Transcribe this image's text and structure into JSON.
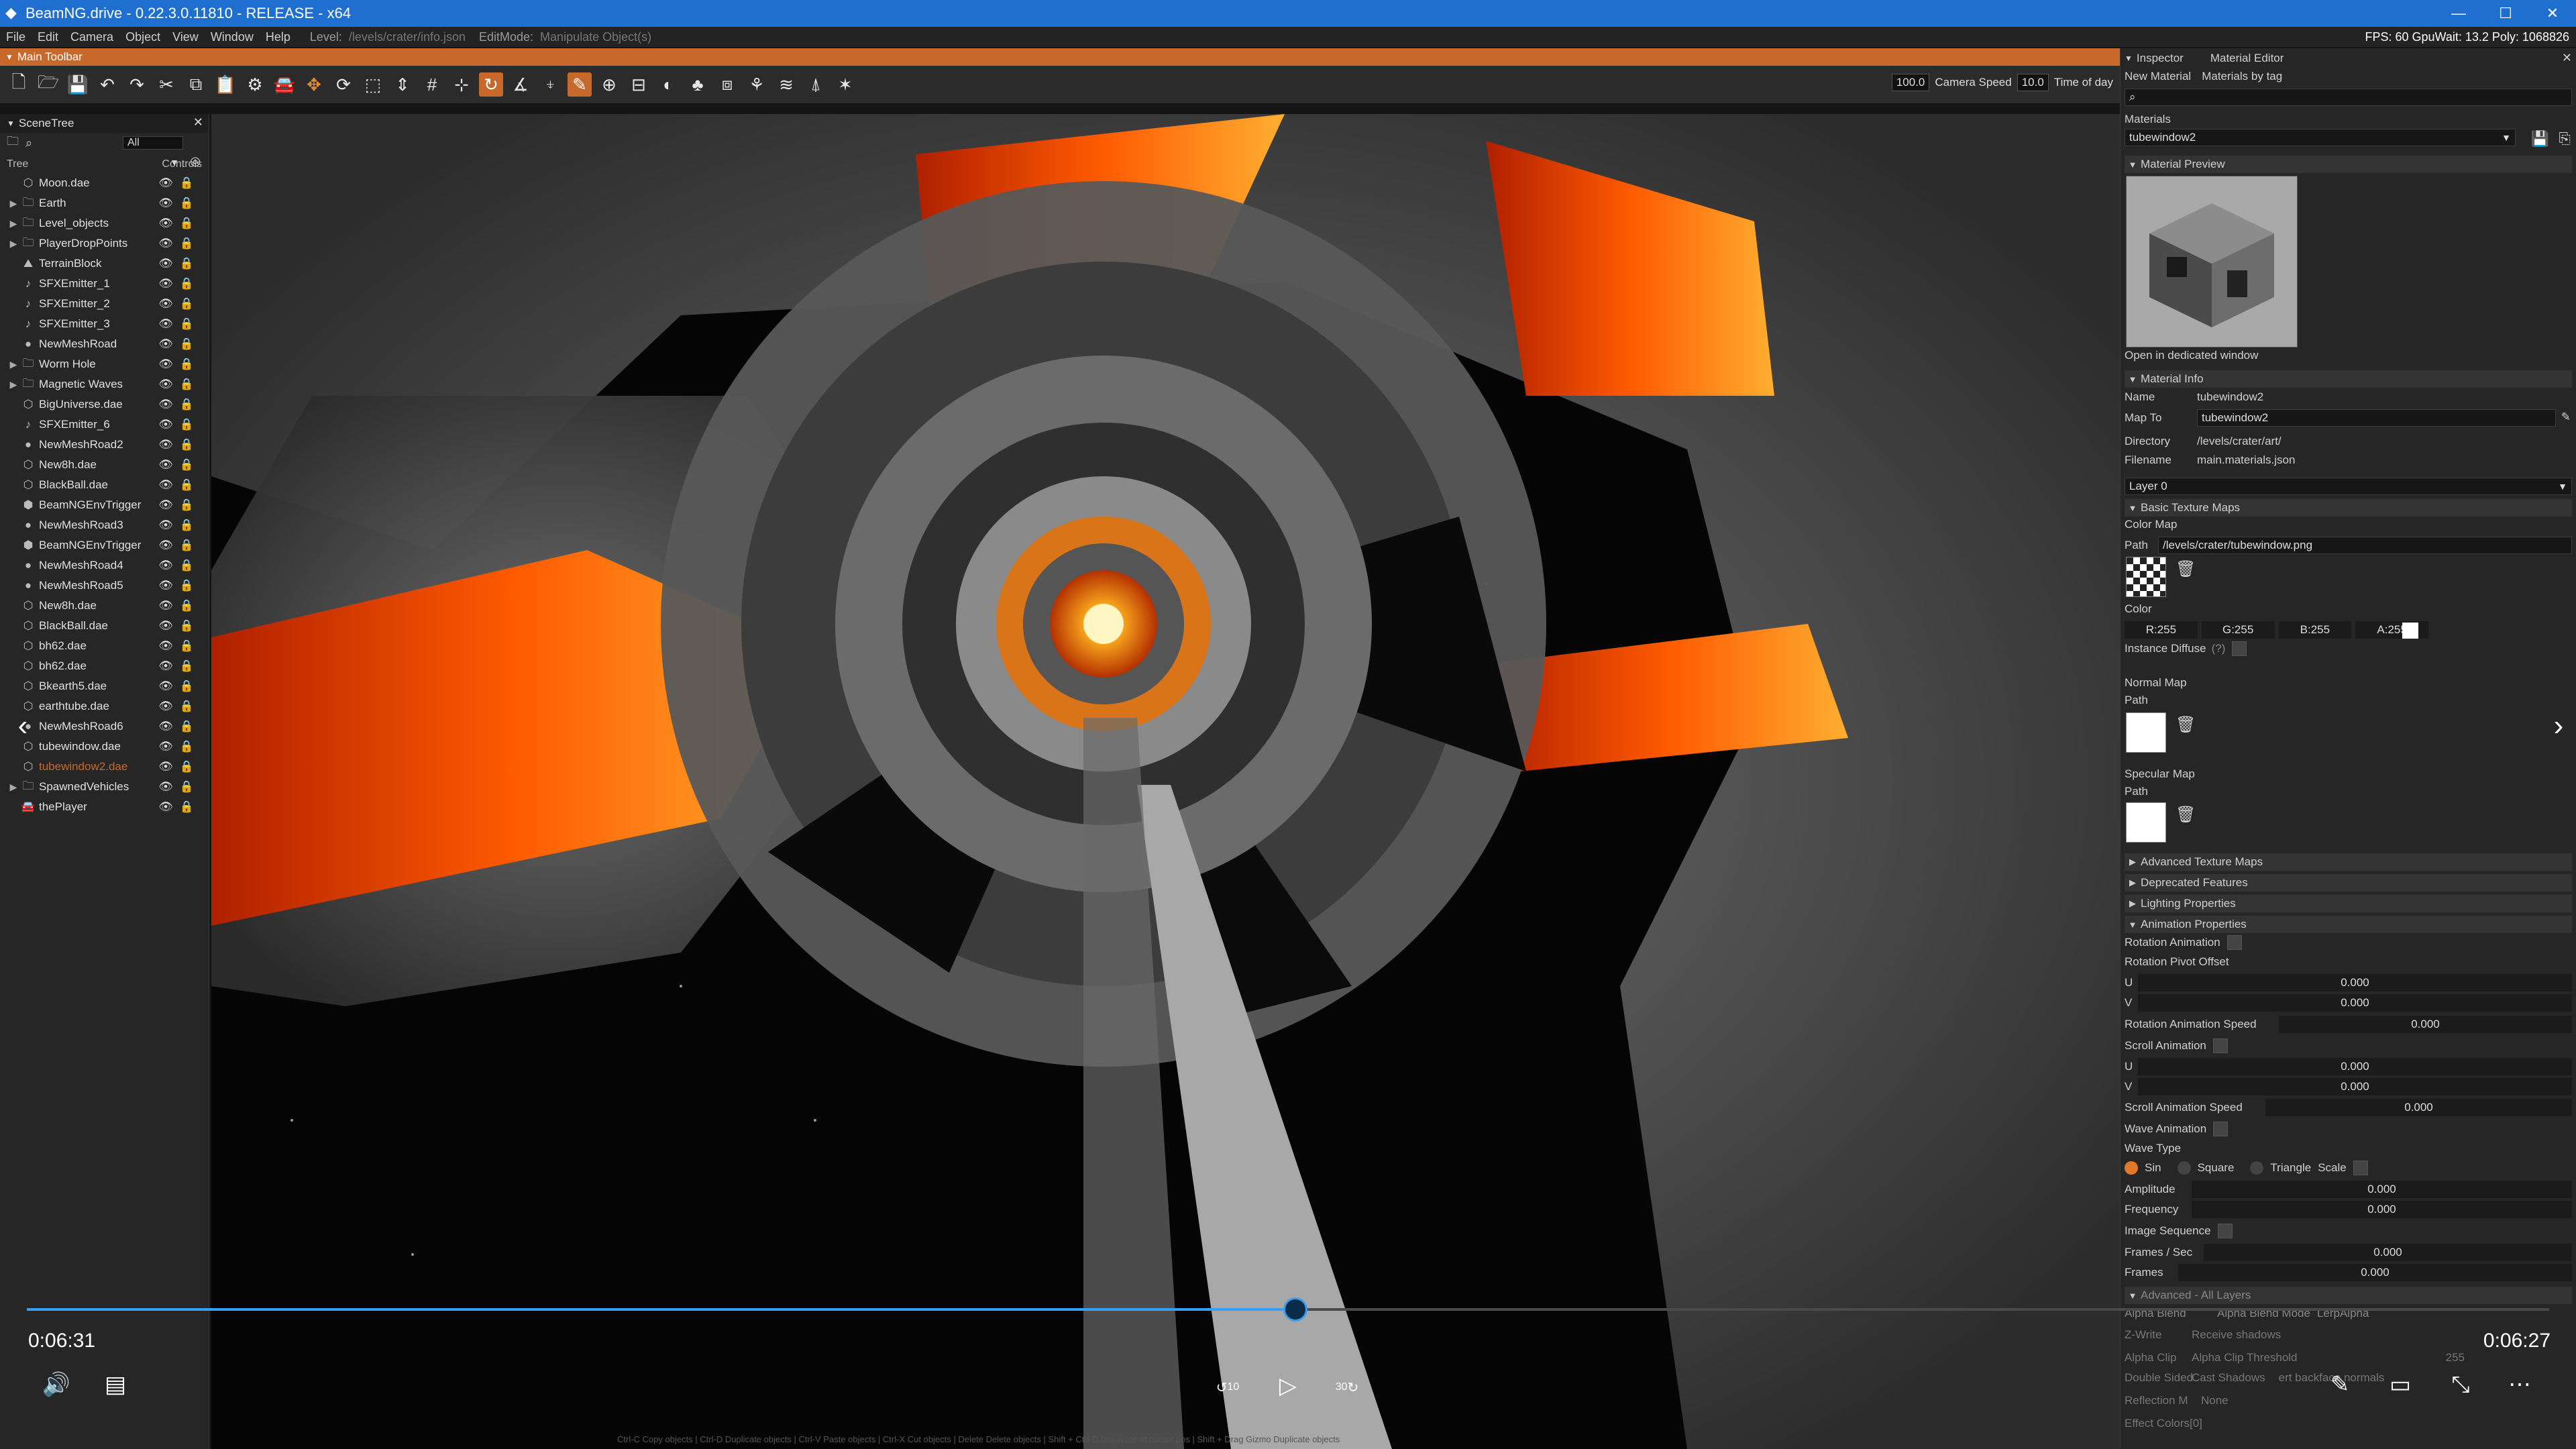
{
  "window": {
    "title": "BeamNG.drive - 0.22.3.0.11810 - RELEASE - x64",
    "minimize": "—",
    "maximize": "☐",
    "close": "✕"
  },
  "menubar": {
    "items": [
      "File",
      "Edit",
      "Camera",
      "Object",
      "View",
      "Window",
      "Help"
    ],
    "level_label": "Level:",
    "level_value": "/levels/crater/info.json",
    "editmode_label": "EditMode:",
    "editmode_value": "Manipulate Object(s)",
    "stats": "FPS: 60  GpuWait: 13.2  Poly: 1068826"
  },
  "toolbar": {
    "title": "Main Toolbar",
    "camera_speed_value": "100.0",
    "camera_speed_label": "Camera Speed",
    "time_value": "10.0",
    "time_label": "Time of day"
  },
  "scenetree": {
    "title": "SceneTree",
    "filter": "All",
    "col_tree": "Tree",
    "col_controls": "Controls",
    "items": [
      {
        "name": "Moon.dae",
        "icon": "mesh-icon",
        "arrow": ""
      },
      {
        "name": "Earth",
        "icon": "folder-icon",
        "arrow": "▶"
      },
      {
        "name": "Level_objects",
        "icon": "folder-icon",
        "arrow": "▶"
      },
      {
        "name": "PlayerDropPoints",
        "icon": "folder-icon",
        "arrow": "▶"
      },
      {
        "name": "TerrainBlock",
        "icon": "terrain-icon",
        "arrow": ""
      },
      {
        "name": "SFXEmitter_1",
        "icon": "sound-icon",
        "arrow": ""
      },
      {
        "name": "SFXEmitter_2",
        "icon": "sound-icon",
        "arrow": ""
      },
      {
        "name": "SFXEmitter_3",
        "icon": "sound-icon",
        "arrow": ""
      },
      {
        "name": "NewMeshRoad",
        "icon": "road-icon",
        "arrow": ""
      },
      {
        "name": "Worm Hole",
        "icon": "folder-icon",
        "arrow": "▶"
      },
      {
        "name": "Magnetic Waves",
        "icon": "folder-icon",
        "arrow": "▶"
      },
      {
        "name": "BigUniverse.dae",
        "icon": "mesh-icon",
        "arrow": ""
      },
      {
        "name": "SFXEmitter_6",
        "icon": "sound-icon",
        "arrow": ""
      },
      {
        "name": "NewMeshRoad2",
        "icon": "road-icon",
        "arrow": ""
      },
      {
        "name": "New8h.dae",
        "icon": "mesh-icon",
        "arrow": ""
      },
      {
        "name": "BlackBall.dae",
        "icon": "mesh-icon",
        "arrow": ""
      },
      {
        "name": "BeamNGEnvTrigger",
        "icon": "trigger-icon",
        "arrow": ""
      },
      {
        "name": "NewMeshRoad3",
        "icon": "road-icon",
        "arrow": ""
      },
      {
        "name": "BeamNGEnvTrigger",
        "icon": "trigger-icon",
        "arrow": ""
      },
      {
        "name": "NewMeshRoad4",
        "icon": "road-icon",
        "arrow": ""
      },
      {
        "name": "NewMeshRoad5",
        "icon": "road-icon",
        "arrow": ""
      },
      {
        "name": "New8h.dae",
        "icon": "mesh-icon",
        "arrow": ""
      },
      {
        "name": "BlackBall.dae",
        "icon": "mesh-icon",
        "arrow": ""
      },
      {
        "name": "bh62.dae",
        "icon": "mesh-icon",
        "arrow": ""
      },
      {
        "name": "bh62.dae",
        "icon": "mesh-icon",
        "arrow": ""
      },
      {
        "name": "Bkearth5.dae",
        "icon": "mesh-icon",
        "arrow": ""
      },
      {
        "name": "earthtube.dae",
        "icon": "mesh-icon",
        "arrow": ""
      },
      {
        "name": "NewMeshRoad6",
        "icon": "road-icon",
        "arrow": ""
      },
      {
        "name": "tubewindow.dae",
        "icon": "mesh-icon",
        "arrow": ""
      },
      {
        "name": "tubewindow2.dae",
        "icon": "mesh-icon",
        "arrow": "",
        "selected": true
      },
      {
        "name": "SpawnedVehicles",
        "icon": "folder-icon",
        "arrow": "▶"
      },
      {
        "name": "thePlayer",
        "icon": "car-icon",
        "arrow": ""
      }
    ]
  },
  "inspector": {
    "tab_inspector": "Inspector",
    "tab_material_editor": "Material Editor",
    "new_material": "New Material",
    "materials_by_tag": "Materials by tag",
    "materials_label": "Materials",
    "material_selected": "tubewindow2",
    "material_preview": "Material Preview",
    "open_dedicated": "Open in dedicated window",
    "material_info": "Material Info",
    "name_label": "Name",
    "name_value": "tubewindow2",
    "mapto_label": "Map To",
    "mapto_value": "tubewindow2",
    "directory_label": "Directory",
    "directory_value": "/levels/crater/art/",
    "filename_label": "Filename",
    "filename_value": "main.materials.json",
    "layer": "Layer 0",
    "basic_texture_maps": "Basic Texture Maps",
    "color_map": "Color Map",
    "path_label": "Path",
    "color_map_path": "/levels/crater/tubewindow.png",
    "color_label": "Color",
    "r": "R:255",
    "g": "G:255",
    "b": "B:255",
    "a": "A:255",
    "instance_diffuse": "Instance Diffuse",
    "instance_diffuse_hint": "(?)",
    "normal_map": "Normal Map",
    "specular_map": "Specular Map",
    "advanced_texture_maps": "Advanced Texture Maps",
    "deprecated_features": "Deprecated Features",
    "lighting_properties": "Lighting Properties",
    "animation_properties": "Animation Properties",
    "rotation_animation": "Rotation Animation",
    "rotation_pivot_offset": "Rotation Pivot Offset",
    "u_label": "U",
    "v_label": "V",
    "rot_u": "0.000",
    "rot_v": "0.000",
    "rotation_animation_speed": "Rotation Animation Speed",
    "rot_speed": "0.000",
    "scroll_animation": "Scroll Animation",
    "scroll_u": "0.000",
    "scroll_v": "0.000",
    "scroll_animation_speed": "Scroll Animation Speed",
    "scroll_speed": "0.000",
    "wave_animation": "Wave Animation",
    "wave_type": "Wave Type",
    "wave_sin": "Sin",
    "wave_square": "Square",
    "wave_triangle": "Triangle",
    "wave_scale": "Scale",
    "amplitude": "Amplitude",
    "amplitude_value": "0.000",
    "frequency": "Frequency",
    "frequency_value": "0.000",
    "image_sequence": "Image Sequence",
    "frames_sec": "Frames / Sec",
    "frames_sec_value": "0.000",
    "frames": "Frames",
    "frames_value": "0.000",
    "advanced_all_layers": "Advanced - All Layers",
    "alpha_blend": "Alpha Blend",
    "alpha_blend_mode": "Alpha Blend Mode",
    "alpha_blend_mode_value": "LerpAlpha",
    "z_write": "Z-Write",
    "receive_shadows": "Receive shadows",
    "alpha_clip": "Alpha Clip",
    "alpha_clip_threshold": "Alpha Clip Threshold",
    "alpha_clip_value": "255",
    "double_sided": "Double Sided",
    "cast_shadows": "Cast Shadows",
    "back_normal": "ert backface normals",
    "reflection": "Reflection M",
    "reflection_value": "None",
    "effect_colors": "Effect Colors[0]"
  },
  "player": {
    "elapsed": "0:06:31",
    "remaining": "0:06:27",
    "progress": 0.503,
    "skip_back": "10",
    "skip_forward": "30"
  },
  "hints": "Ctrl-C Copy objects  |  Ctrl-D Duplicate objects  |  Ctrl-V Paste objects  |  Ctrl-X Cut objects  |  Delete Delete objects  |  Shift + Ctrl-D Duplicate at cursor pos  |  Shift + Drag Gizmo Duplicate objects"
}
